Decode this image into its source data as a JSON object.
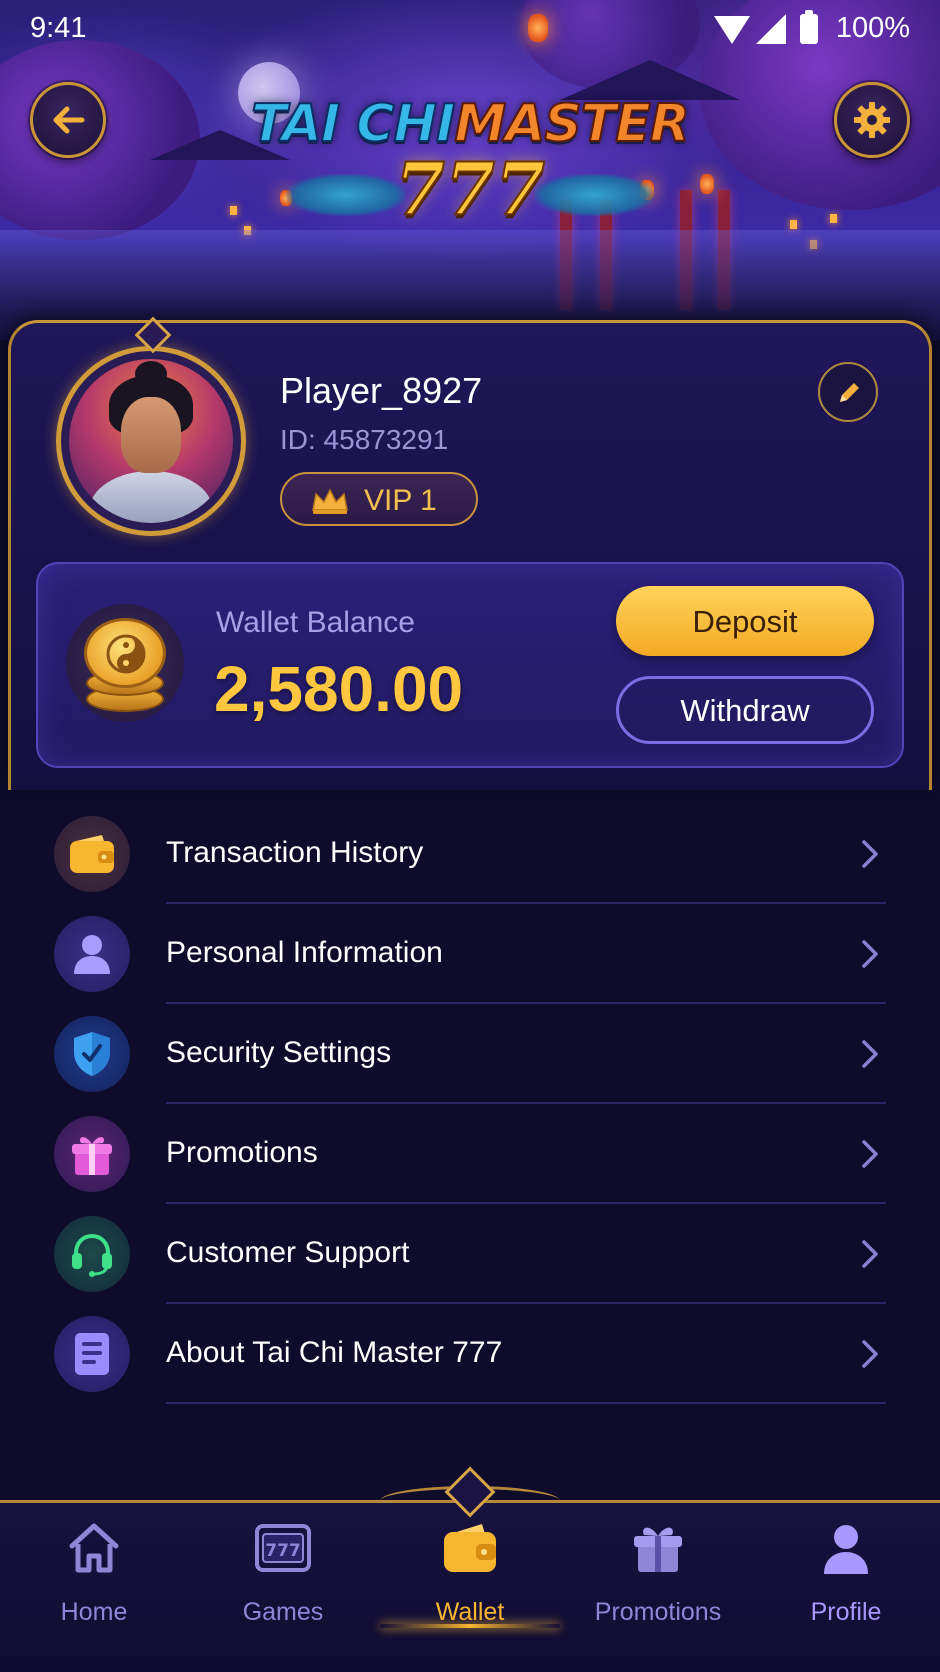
{
  "status_bar": {
    "time": "9:41",
    "battery": "100%"
  },
  "header": {
    "logo_line1_a": "TAI CHI",
    "logo_line1_b": "MASTER",
    "logo_line2": "777"
  },
  "profile": {
    "name": "Player_8927",
    "id": "ID: 45873291",
    "vip": "VIP 1"
  },
  "wallet": {
    "label": "Wallet Balance",
    "balance": "2,580.00",
    "deposit_label": "Deposit",
    "withdraw_label": "Withdraw"
  },
  "menu": {
    "items": [
      {
        "label": "Transaction History",
        "icon": "wallet-icon"
      },
      {
        "label": "Personal Information",
        "icon": "person-icon"
      },
      {
        "label": "Security Settings",
        "icon": "shield-icon"
      },
      {
        "label": "Promotions",
        "icon": "gift-icon"
      },
      {
        "label": "Customer Support",
        "icon": "headset-icon"
      },
      {
        "label": "About Tai Chi Master 777",
        "icon": "document-icon"
      }
    ]
  },
  "bottom_nav": {
    "items": [
      {
        "label": "Home",
        "icon": "home-icon"
      },
      {
        "label": "Games",
        "icon": "slot-777-icon"
      },
      {
        "label": "Wallet",
        "icon": "wallet-icon",
        "active": true
      },
      {
        "label": "Promotions",
        "icon": "gift-icon"
      },
      {
        "label": "Profile",
        "icon": "profile-icon"
      }
    ]
  },
  "colors": {
    "background": "#0e0b2b",
    "gold": "#ffc63f",
    "accent_purple": "#7d6ee6",
    "nav_active": "#f7b530",
    "nav_inactive": "#8f86d8",
    "nav_profile": "#a898ff"
  }
}
